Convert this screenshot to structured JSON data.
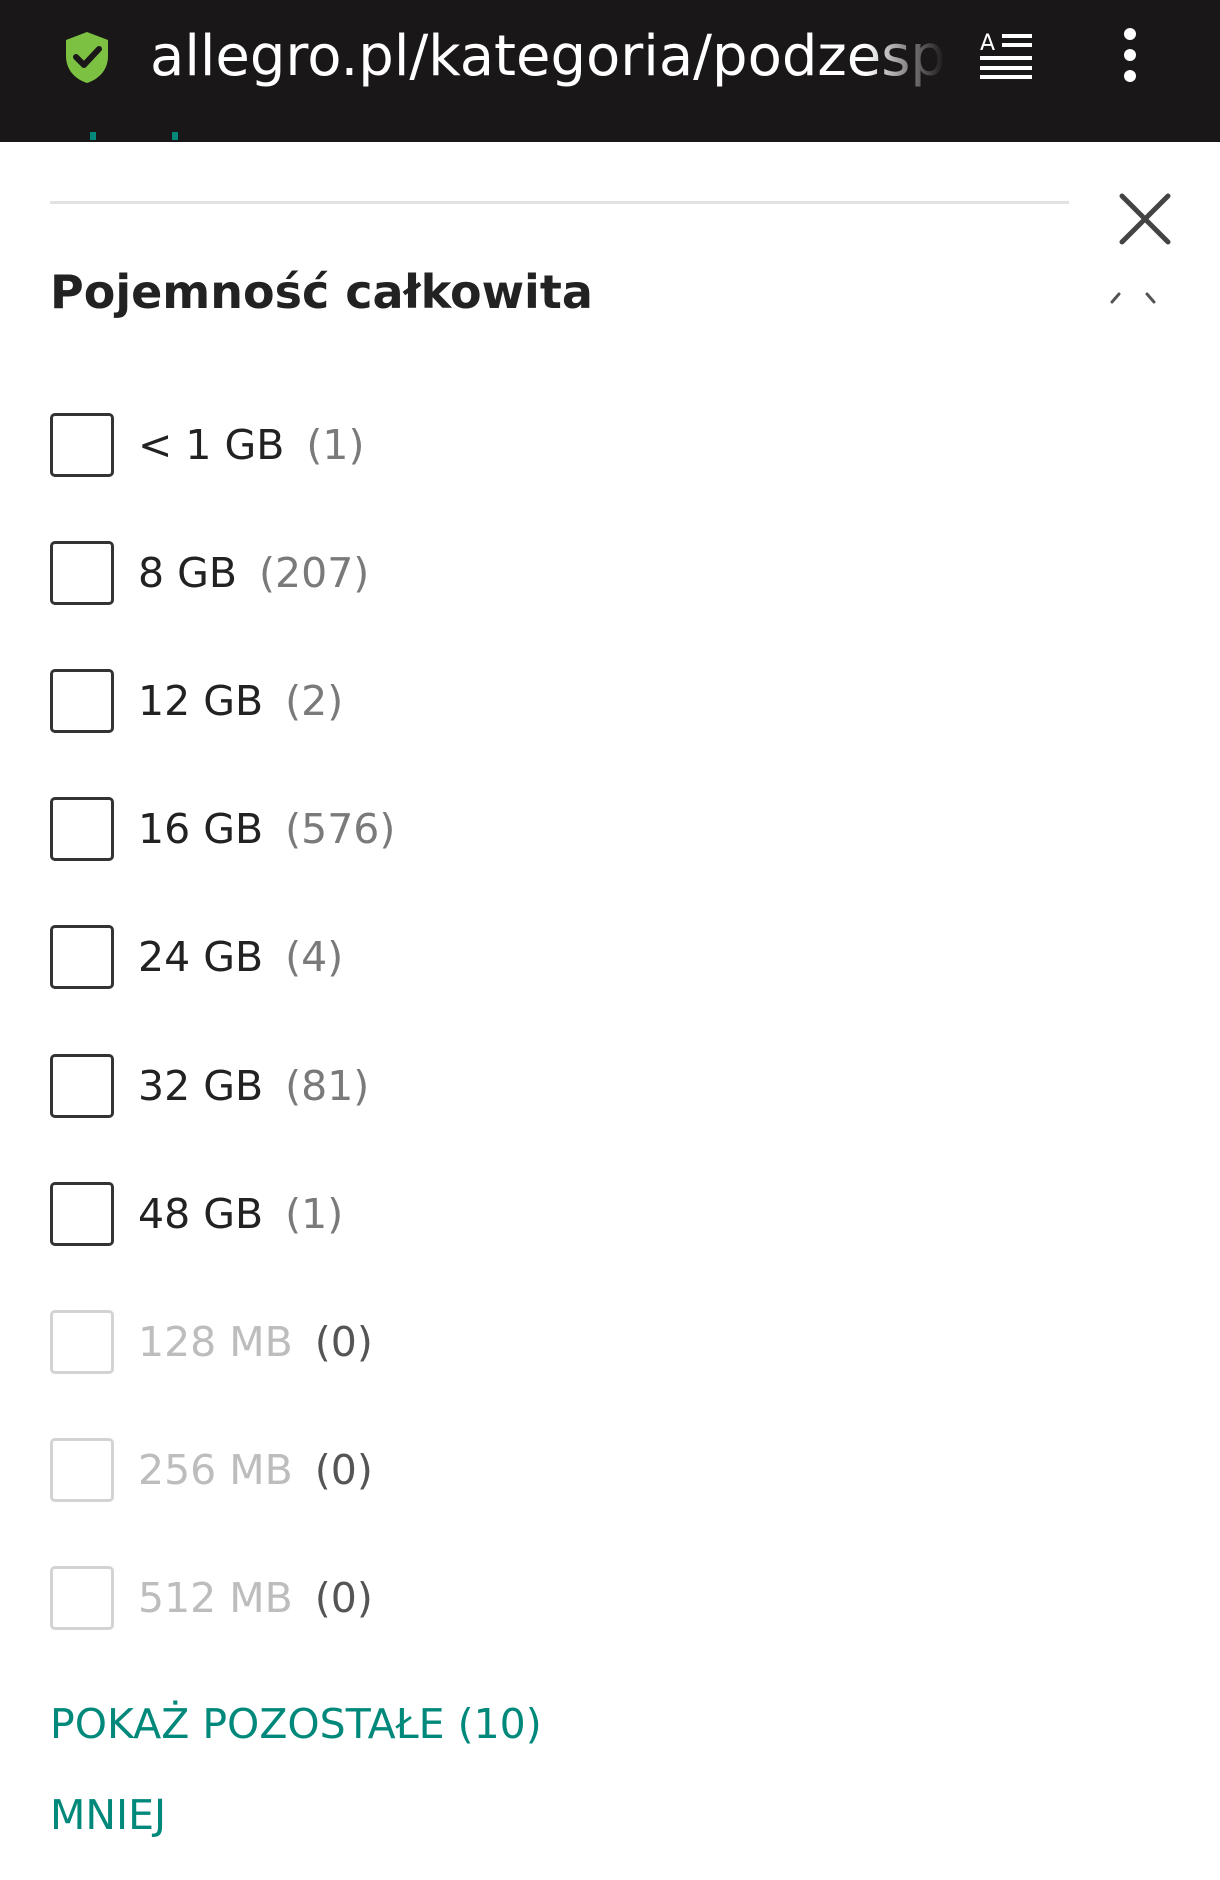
{
  "browser": {
    "url": "allegro.pl/kategoria/podzesp",
    "colors": {
      "bar": "#1a1718",
      "secure": "#7dc142"
    },
    "icons": [
      "shield-check-icon",
      "reader-mode-icon",
      "more-vert-icon"
    ]
  },
  "filter": {
    "title": "Pojemność całkowita",
    "options": [
      {
        "label": "< 1 GB",
        "count": "(1)",
        "enabled": true
      },
      {
        "label": "8 GB",
        "count": "(207)",
        "enabled": true
      },
      {
        "label": "12 GB",
        "count": "(2)",
        "enabled": true
      },
      {
        "label": "16 GB",
        "count": "(576)",
        "enabled": true
      },
      {
        "label": "24 GB",
        "count": "(4)",
        "enabled": true
      },
      {
        "label": "32 GB",
        "count": "(81)",
        "enabled": true
      },
      {
        "label": "48 GB",
        "count": "(1)",
        "enabled": true
      },
      {
        "label": "128 MB",
        "count": "(0)",
        "enabled": false
      },
      {
        "label": "256 MB",
        "count": "(0)",
        "enabled": false
      },
      {
        "label": "512 MB",
        "count": "(0)",
        "enabled": false
      }
    ],
    "show_more": "POKAŻ POZOSTAŁE (10)",
    "show_less": "MNIEJ",
    "accent": "#00897b"
  }
}
